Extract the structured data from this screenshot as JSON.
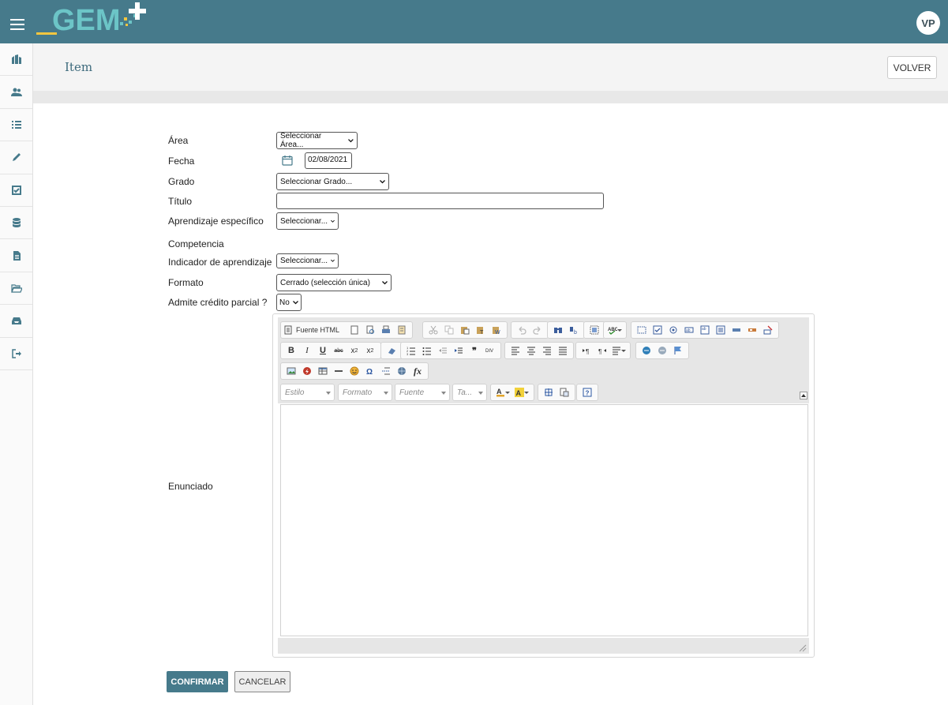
{
  "header": {
    "logo_text": "GEM",
    "avatar_initials": "VP",
    "colors": {
      "primary": "#467a8b",
      "logo_teal": "#6cc5c7",
      "logo_yellow": "#f3c63f"
    }
  },
  "sidebar": {
    "items": [
      {
        "icon": "institution-icon"
      },
      {
        "icon": "users-icon"
      },
      {
        "icon": "list-icon"
      },
      {
        "icon": "pencil-icon"
      },
      {
        "icon": "checkbox-icon"
      },
      {
        "icon": "database-icon"
      },
      {
        "icon": "document-icon"
      },
      {
        "icon": "folder-open-icon"
      },
      {
        "icon": "inbox-icon"
      },
      {
        "icon": "sign-out-icon"
      }
    ]
  },
  "page": {
    "title": "Item",
    "back_button": "VOLVER"
  },
  "form": {
    "area_label": "Área",
    "area_value": "Seleccionar Área...",
    "fecha_label": "Fecha",
    "fecha_value": "02/08/2021",
    "grado_label": "Grado",
    "grado_value": "Seleccionar Grado...",
    "titulo_label": "Título",
    "titulo_value": "",
    "aprendizaje_label": "Aprendizaje específico",
    "aprendizaje_value": "Seleccionar...",
    "competencia_label": "Competencia",
    "indicador_label": "Indicador de aprendizaje",
    "indicador_value": "Seleccionar...",
    "formato_label": "Formato",
    "formato_value": "Cerrado (selección única)",
    "credito_label": "Admite crédito parcial ?",
    "credito_value": "No",
    "enunciado_label": "Enunciado"
  },
  "editor": {
    "source_label": "Fuente HTML",
    "combo_style": "Estilo",
    "combo_format": "Formato",
    "combo_font": "Fuente",
    "combo_size": "Ta..."
  },
  "actions": {
    "confirm": "CONFIRMAR",
    "cancel": "CANCELAR"
  }
}
